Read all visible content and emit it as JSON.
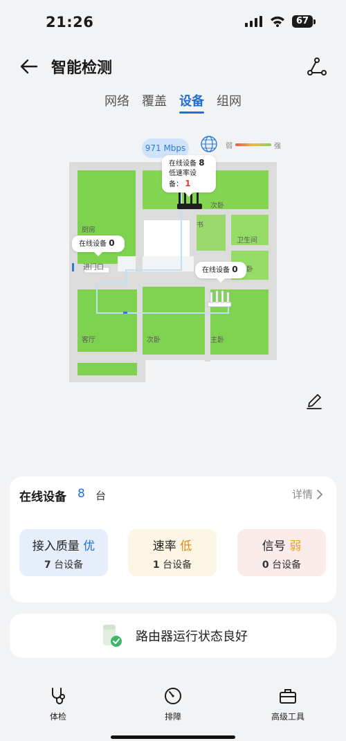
{
  "status_bar": {
    "time": "21:26",
    "battery": "67"
  },
  "header": {
    "title": "智能检测"
  },
  "tabs": [
    {
      "label": "网络"
    },
    {
      "label": "覆盖"
    },
    {
      "label": "设备"
    },
    {
      "label": "组网"
    }
  ],
  "map": {
    "speed": "971 Mbps",
    "legend": {
      "weak": "弱",
      "strong": "强"
    },
    "main_router": {
      "online_label": "在线设备",
      "online_count": "8",
      "slow_label": "低速率设备：",
      "slow_count": "1"
    },
    "entrance_node": {
      "online_label": "在线设备",
      "online_count": "0"
    },
    "bedroom_node": {
      "online_label": "在线设备",
      "online_count": "0"
    },
    "rooms": [
      "厨房",
      "次卧",
      "书",
      "卫生间",
      "进门口",
      "卧",
      "客厅",
      "次卧",
      "主卧"
    ]
  },
  "devices_card": {
    "title": "在线设备",
    "count": "8",
    "unit": "台",
    "details": "详情",
    "metrics": [
      {
        "label": "接入质量",
        "grade": "优",
        "count": "7",
        "unit": "台设备"
      },
      {
        "label": "速率",
        "grade": "低",
        "count": "1",
        "unit": "台设备"
      },
      {
        "label": "信号",
        "grade": "弱",
        "count": "0",
        "unit": "台设备"
      }
    ]
  },
  "router_status": {
    "text": "路由器运行状态良好"
  },
  "bottom_nav": [
    {
      "label": "体检",
      "icon": "stethoscope-icon"
    },
    {
      "label": "排障",
      "icon": "gauge-icon"
    },
    {
      "label": "高级工具",
      "icon": "toolbox-icon"
    }
  ],
  "colors": {
    "accent": "#1f6fd6",
    "coverage": "#7ed34e"
  }
}
